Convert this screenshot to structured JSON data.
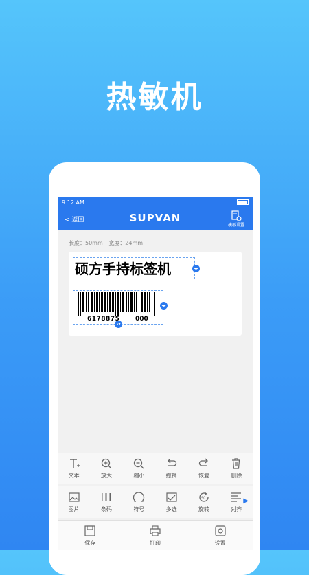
{
  "headline": "热敏机",
  "status": {
    "time": "9:12 AM"
  },
  "nav": {
    "back": "< 返回",
    "brand": "SUPVAN",
    "template_settings": "模板设置"
  },
  "label_meta": {
    "length": "长度：50mm",
    "width": "宽度：24mm"
  },
  "label": {
    "text": "硕方手持标签机",
    "barcode_number_left": "6178875",
    "barcode_number_right": "000"
  },
  "toolbar1": [
    {
      "icon": "text-icon",
      "label": "文本"
    },
    {
      "icon": "zoom-in-icon",
      "label": "放大"
    },
    {
      "icon": "zoom-out-icon",
      "label": "缩小"
    },
    {
      "icon": "undo-icon",
      "label": "撤销"
    },
    {
      "icon": "redo-icon",
      "label": "恢复"
    },
    {
      "icon": "trash-icon",
      "label": "删除"
    }
  ],
  "toolbar2": [
    {
      "icon": "image-icon",
      "label": "图片"
    },
    {
      "icon": "barcode-icon",
      "label": "条码"
    },
    {
      "icon": "symbol-icon",
      "label": "符号"
    },
    {
      "icon": "multi-select-icon",
      "label": "多选"
    },
    {
      "icon": "rotate-icon",
      "label": "旋转"
    },
    {
      "icon": "align-icon",
      "label": "对齐"
    }
  ],
  "bottom": [
    {
      "icon": "save-icon",
      "label": "保存"
    },
    {
      "icon": "print-icon",
      "label": "打印"
    },
    {
      "icon": "settings-icon",
      "label": "设置"
    }
  ],
  "colors": {
    "accent": "#2a79ee",
    "bg_top": "#55c5fb",
    "bg_bottom": "#2f86f2"
  }
}
